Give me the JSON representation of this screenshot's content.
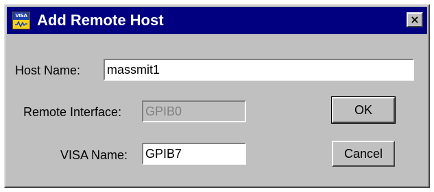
{
  "window": {
    "title": "Add Remote Host",
    "close_label": "×",
    "app_icon_text": "VISA"
  },
  "form": {
    "host_name": {
      "label": "Host Name:",
      "value": "massmit1"
    },
    "remote_interface": {
      "label": "Remote Interface:",
      "value": "GPIB0"
    },
    "visa_name": {
      "label": "VISA Name:",
      "value": "GPIB7"
    }
  },
  "buttons": {
    "ok_label": "OK",
    "cancel_label": "Cancel"
  },
  "colors": {
    "titlebar": "#000080",
    "dialog_face": "#c0c0c0",
    "disabled_text": "#808080"
  }
}
